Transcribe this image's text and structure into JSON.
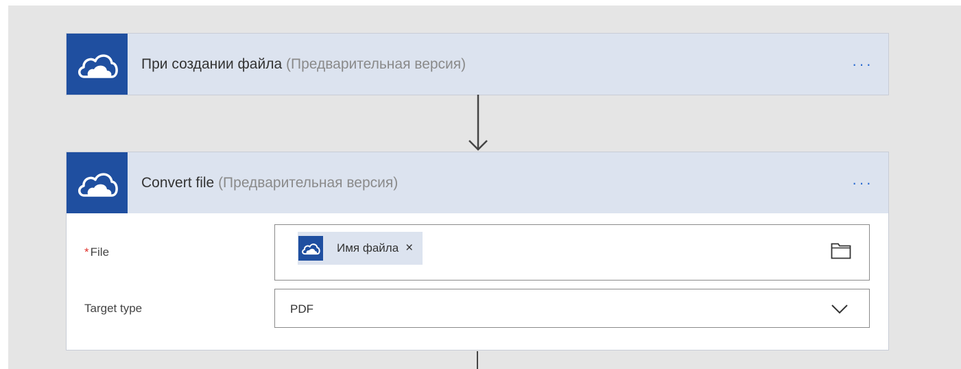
{
  "flow": {
    "trigger": {
      "title": "При создании файла",
      "subtitle": "(Предварительная версия)",
      "icon": "onedrive-cloud-icon",
      "more_label": "···"
    },
    "action": {
      "title": "Convert file",
      "subtitle": "(Предварительная версия)",
      "icon": "onedrive-cloud-icon",
      "more_label": "···",
      "fields": {
        "file": {
          "required_mark": "*",
          "label": "File",
          "token_label": "Имя файла",
          "token_remove": "×",
          "token_icon": "onedrive-cloud-icon",
          "picker_icon": "folder-icon"
        },
        "target_type": {
          "label": "Target type",
          "value": "PDF",
          "dropdown_icon": "chevron-down-icon"
        }
      }
    }
  },
  "colors": {
    "canvas_bg": "#e5e5e5",
    "header_bg": "#dce3ef",
    "icon_bg": "#1f4fa0",
    "accent": "#2a6bd1",
    "required": "#e0312b"
  }
}
